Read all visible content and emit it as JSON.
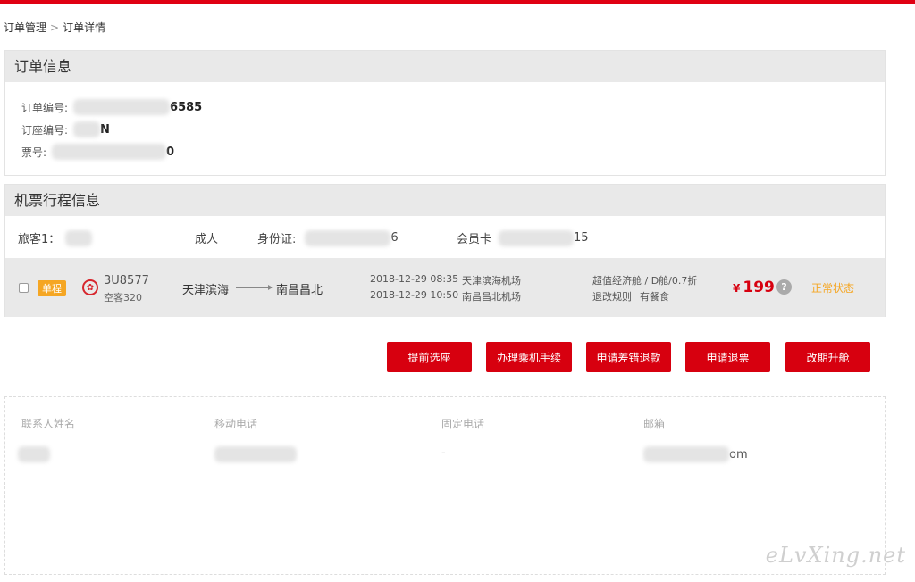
{
  "colors": {
    "brand": "#e00012",
    "button": "#d7000f",
    "status": "#f5a623",
    "tag": "#f5a623"
  },
  "breadcrumb": {
    "parent": "订单管理",
    "sep": ">",
    "current": "订单详情"
  },
  "order_info": {
    "title": "订单信息",
    "order_no_label": "订单编号:",
    "order_no_suffix": "6585",
    "booking_no_label": "订座编号:",
    "booking_no_suffix": "N",
    "ticket_no_label": "票号:",
    "ticket_no_suffix": "0"
  },
  "itinerary": {
    "title": "机票行程信息",
    "passenger": {
      "label": "旅客1：",
      "type": "成人",
      "id_label": "身份证:",
      "id_suffix": "6",
      "member_label": "会员卡",
      "member_suffix": "15"
    },
    "flight": {
      "trip_tag": "单程",
      "airline_icon": "sichuan-airlines-logo",
      "flight_no": "3U8577",
      "plane": "空客320",
      "from_city": "天津滨海",
      "to_city": "南昌昌北",
      "dep_time": "2018-12-29 08:35",
      "dep_airport": "天津滨海机场",
      "arr_time": "2018-12-29 10:50",
      "arr_airport": "南昌昌北机场",
      "cabin": "超值经济舱 / D舱/0.7折",
      "rules": "退改规则",
      "meal": "有餐食",
      "currency": "¥",
      "price": "199",
      "help": "?",
      "status": "正常状态"
    }
  },
  "actions": {
    "seat": "提前选座",
    "checkin": "办理乘机手续",
    "refund_error": "申请差错退款",
    "refund": "申请退票",
    "change": "改期升舱"
  },
  "contact": {
    "name_label": "联系人姓名",
    "mobile_label": "移动电话",
    "phone_label": "固定电话",
    "email_label": "邮箱",
    "phone_value": "-",
    "email_suffix": "om"
  },
  "watermark": "eLvXing.net"
}
